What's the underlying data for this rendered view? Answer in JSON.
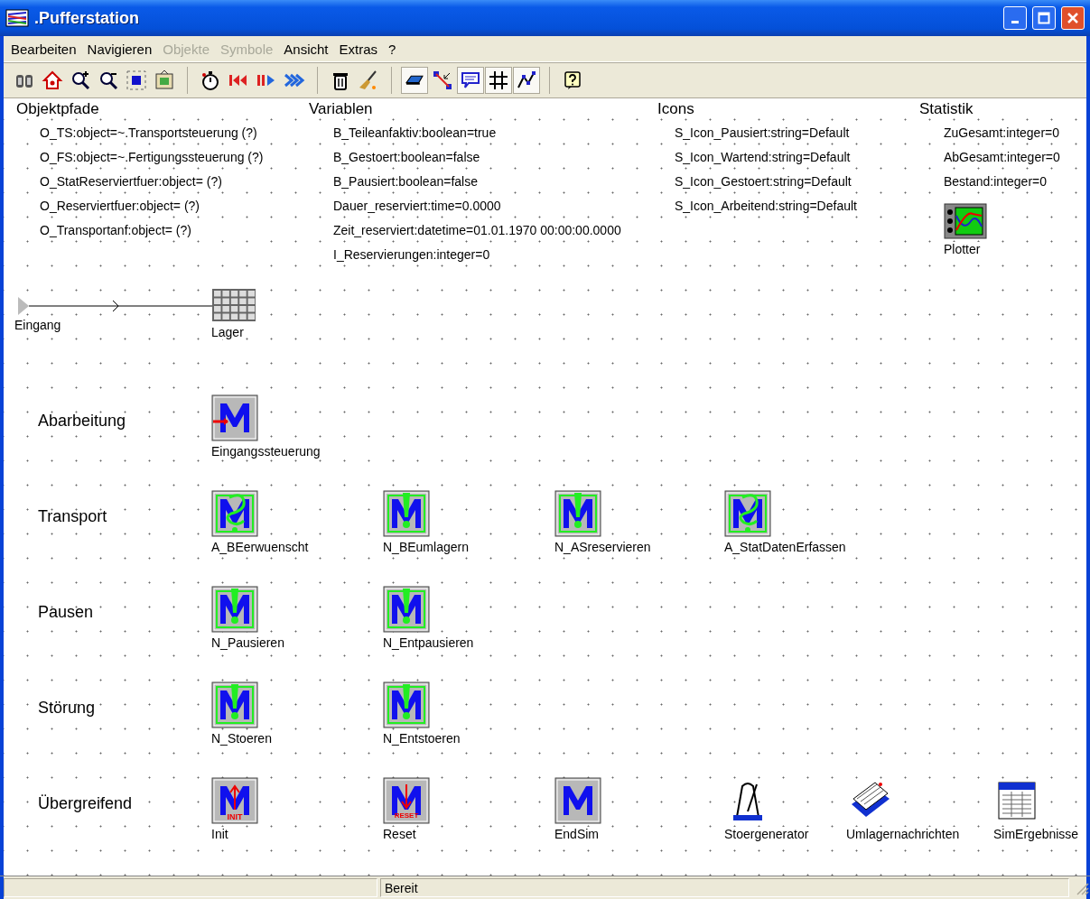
{
  "window": {
    "title": ".Pufferstation"
  },
  "menu": [
    {
      "label": "Bearbeiten",
      "disabled": false
    },
    {
      "label": "Navigieren",
      "disabled": false
    },
    {
      "label": "Objekte",
      "disabled": true
    },
    {
      "label": "Symbole",
      "disabled": true
    },
    {
      "label": "Ansicht",
      "disabled": false
    },
    {
      "label": "Extras",
      "disabled": false
    },
    {
      "label": "?",
      "disabled": false
    }
  ],
  "toolbar": [
    [
      {
        "kind": "binoculars",
        "pressed": false
      },
      {
        "kind": "home",
        "pressed": false
      },
      {
        "kind": "zoom-in",
        "pressed": false
      },
      {
        "kind": "zoom-out",
        "pressed": false
      },
      {
        "kind": "select",
        "pressed": false
      },
      {
        "kind": "picture",
        "pressed": false
      }
    ],
    [
      {
        "kind": "stopwatch",
        "pressed": false
      },
      {
        "kind": "rewind",
        "pressed": false
      },
      {
        "kind": "step",
        "pressed": false
      },
      {
        "kind": "fast-forward",
        "pressed": false
      }
    ],
    [
      {
        "kind": "trash",
        "pressed": false
      },
      {
        "kind": "broom",
        "pressed": false
      }
    ],
    [
      {
        "kind": "eraser",
        "pressed": true
      },
      {
        "kind": "connector",
        "pressed": false
      },
      {
        "kind": "comment",
        "pressed": true
      },
      {
        "kind": "grid",
        "pressed": true
      },
      {
        "kind": "graph",
        "pressed": true
      }
    ],
    [
      {
        "kind": "help",
        "pressed": false
      }
    ]
  ],
  "attribute_groups": [
    {
      "title": "Objektpfade",
      "items": [
        "O_TS:object=~.Transportsteuerung (?)",
        "O_FS:object=~.Fertigungssteuerung (?)",
        "O_StatReserviertfuer:object= (?)",
        "O_Reserviertfuer:object= (?)",
        "O_Transportanf:object= (?)"
      ]
    },
    {
      "title": "Variablen",
      "items": [
        "B_Teileanfaktiv:boolean=true",
        "B_Gestoert:boolean=false",
        "B_Pausiert:boolean=false",
        "Dauer_reserviert:time=0.0000",
        "Zeit_reserviert:datetime=01.01.1970 00:00:00.0000",
        "I_Reservierungen:integer=0"
      ]
    },
    {
      "title": "Icons",
      "items": [
        "S_Icon_Pausiert:string=Default",
        "S_Icon_Wartend:string=Default",
        "S_Icon_Gestoert:string=Default",
        "S_Icon_Arbeitend:string=Default"
      ]
    },
    {
      "title": "Statistik",
      "items": [
        "ZuGesamt:integer=0",
        "AbGesamt:integer=0",
        "Bestand:integer=0"
      ]
    }
  ],
  "plotter": {
    "label": "Plotter"
  },
  "source": {
    "label": "Eingang"
  },
  "store": {
    "label": "Lager"
  },
  "sections": [
    {
      "label": "Abarbeitung",
      "nodes": [
        {
          "label": "Eingangssteuerung",
          "kind": "method-input"
        }
      ]
    },
    {
      "label": "Transport",
      "nodes": [
        {
          "label": "A_BEerwuenscht",
          "kind": "method-action"
        },
        {
          "label": "N_BEumlagern",
          "kind": "method-notify"
        },
        {
          "label": "N_ASreservieren",
          "kind": "method-notify"
        },
        {
          "label": "A_StatDatenErfassen",
          "kind": "method-action"
        }
      ]
    },
    {
      "label": "Pausen",
      "nodes": [
        {
          "label": "N_Pausieren",
          "kind": "method-notify"
        },
        {
          "label": "N_Entpausieren",
          "kind": "method-notify"
        }
      ]
    },
    {
      "label": "Störung",
      "nodes": [
        {
          "label": "N_Stoeren",
          "kind": "method-notify"
        },
        {
          "label": "N_Entstoeren",
          "kind": "method-notify"
        }
      ]
    },
    {
      "label": "Übergreifend",
      "nodes": [
        {
          "label": "Init",
          "kind": "method-init",
          "icon_text": "INIT"
        },
        {
          "label": "Reset",
          "kind": "method-reset",
          "icon_text": "RESET"
        },
        {
          "label": "EndSim",
          "kind": "method"
        },
        {
          "label": "Stoergenerator",
          "kind": "generator"
        },
        {
          "label": "Umlagernachrichten",
          "kind": "card-file"
        },
        {
          "label": "SimErgebnisse",
          "kind": "table"
        }
      ]
    }
  ],
  "status_bar": {
    "text": "Bereit"
  }
}
